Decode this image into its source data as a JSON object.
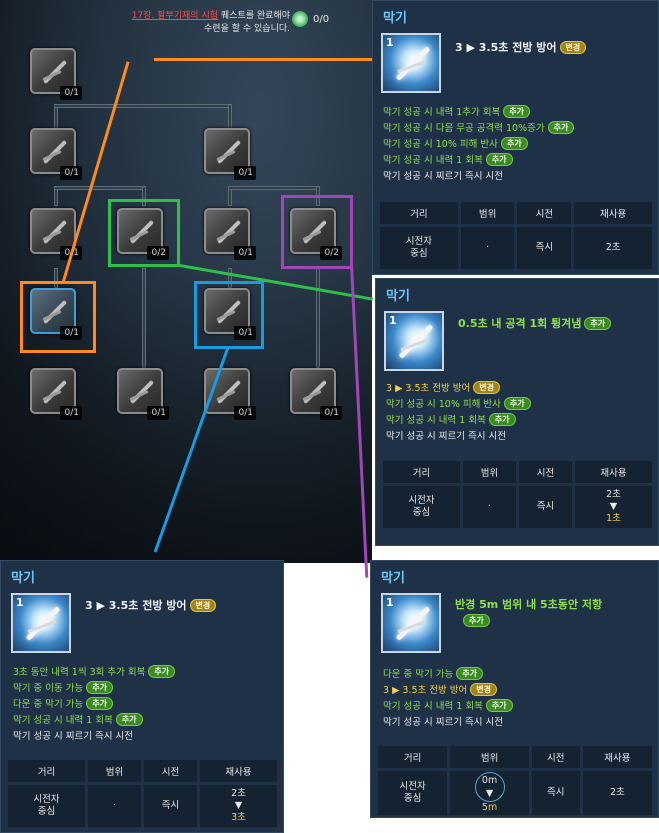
{
  "quest": {
    "name": "17장. 팔부기재의 시험",
    "suffix": "퀘스트를 완료해야",
    "line2": "수련을 할 수 있습니다.",
    "count": "0/0",
    "count_icon": "spiral-icon"
  },
  "tree": {
    "nodes": [
      {
        "count": "0/1"
      },
      {
        "count": "0/1"
      },
      {
        "count": "0/1"
      },
      {
        "count": "0/1"
      },
      {
        "count": "0/2"
      },
      {
        "count": "0/1"
      },
      {
        "count": "0/2"
      },
      {
        "count": "0/1"
      },
      {
        "count": "0/1"
      },
      {
        "count": "0/1"
      },
      {
        "count": "0/1"
      },
      {
        "count": "0/1"
      },
      {
        "count": "0/1"
      }
    ]
  },
  "colors": {
    "orange": "#ff8a1f",
    "green": "#2fbf4a",
    "blue": "#1a9be0",
    "purple": "#a046b8",
    "panel_bg": "#1e3147",
    "title_blue": "#6ec6f5",
    "effect_green": "#8fe04a",
    "effect_yellow": "#f5d247"
  },
  "labels": {
    "add": "추가",
    "change": "변경",
    "col_range": "거리",
    "col_area": "범위",
    "col_cast": "시전",
    "col_cooldown": "재사용"
  },
  "panels": {
    "p1": {
      "title": "막기",
      "level": "1",
      "headline": "3 ▶ 3.5초 전방 방어",
      "effects": [
        {
          "text": "막기 성공 시 내력 1추가 회복",
          "badge": "추가"
        },
        {
          "text": "막기 성공 시 다음 무공 공격력 10%증가",
          "badge": "추가"
        },
        {
          "text": "막기 성공 시 10% 피해 반사",
          "badge": "추가"
        },
        {
          "text": "막기 성공 시 내력 1 회복",
          "badge": "추가"
        },
        {
          "text": "막기 성공 시 찌르기 즉시 시전"
        }
      ],
      "range": "시전자\n중심",
      "area": "·",
      "cast": "즉시",
      "cooldown": "2초"
    },
    "p2": {
      "title": "막기",
      "level": "1",
      "headline": "0.5초 내 공격 1회 튕겨냄",
      "effects": [
        {
          "text": "3 ▶ 3.5초 전방 방어",
          "badge": "변경"
        },
        {
          "text": "막기 성공 시 10% 피해 반사",
          "badge": "추가"
        },
        {
          "text": "막기 성공 시 내력 1 회복",
          "badge": "추가"
        },
        {
          "text": "막기 성공 시 찌르기 즉시 시전"
        }
      ],
      "range": "시전자\n중심",
      "area": "·",
      "cast": "즉시",
      "cooldown_from": "2초",
      "cooldown_arrow": "▼",
      "cooldown_to": "1초"
    },
    "p3": {
      "title": "막기",
      "level": "1",
      "headline": "3 ▶ 3.5초 전방 방어",
      "effects": [
        {
          "text": "3초 동안 내력 1씩 3회 추가 회복",
          "badge": "추가"
        },
        {
          "text": "막기 중 이동 가능",
          "badge": "추가"
        },
        {
          "text": "다운 중 막기 가능",
          "badge": "추가"
        },
        {
          "text": "막기 성공 시 내력 1 회복",
          "badge": "추가"
        },
        {
          "text": "막기 성공 시 찌르기 즉시 시전"
        }
      ],
      "range": "시전자\n중심",
      "area": "·",
      "cast": "즉시",
      "cooldown_from": "2초",
      "cooldown_arrow": "▼",
      "cooldown_to": "3초"
    },
    "p4": {
      "title": "막기",
      "level": "1",
      "headline": "반경 5m 범위 내 5초동안 저항",
      "effects": [
        {
          "text": "다운 중 막기 가능",
          "badge": "추가"
        },
        {
          "text": "3 ▶ 3.5초 전방 방어",
          "badge": "변경"
        },
        {
          "text": "막기 성공 시 내력 1 회복",
          "badge": "추가"
        },
        {
          "text": "막기 성공 시 찌르기 즉시 시전"
        }
      ],
      "range": "시전자\n중심",
      "area_from": "0m",
      "area_arrow": "▼",
      "area_to": "5m",
      "cast": "즉시",
      "cooldown": "2초"
    }
  }
}
